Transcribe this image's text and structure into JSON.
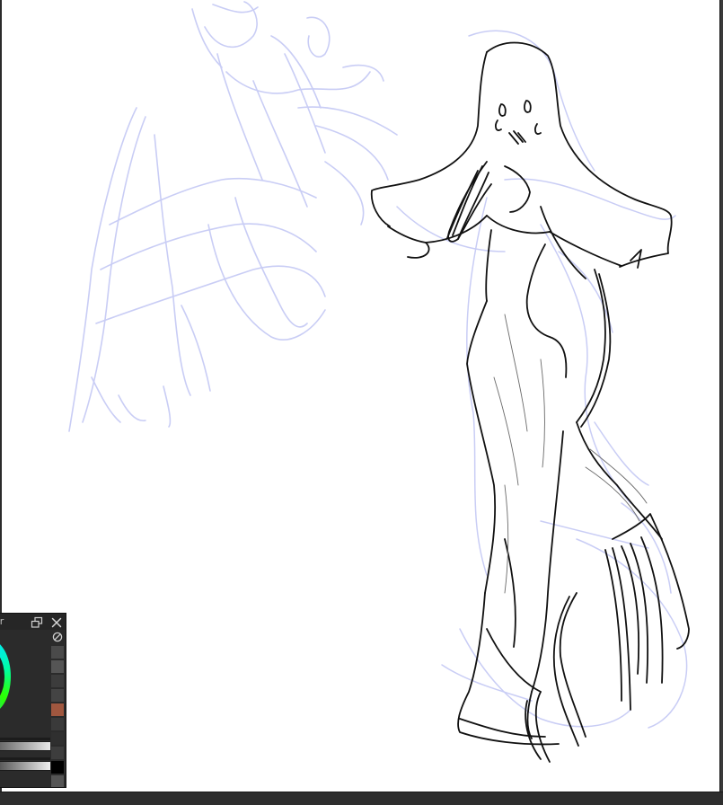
{
  "colors": {
    "sketch_blue": "#c9cdf5",
    "ink": "#111111",
    "canvas_bg": "#ffffff",
    "panel_bg": "#2b2b2b"
  },
  "color_panel": {
    "title": "or",
    "popout_icon": "popout-icon",
    "close_icon": "close-icon",
    "no_color_icon": "no-color-icon",
    "swatches": [
      "#4a4a4a",
      "#555555",
      "#3c3c3c",
      "#444444",
      "#a0573f",
      "#3a3a3a",
      "#2f2f2f",
      "#3d3d3d",
      "#000000",
      "#555555"
    ]
  }
}
